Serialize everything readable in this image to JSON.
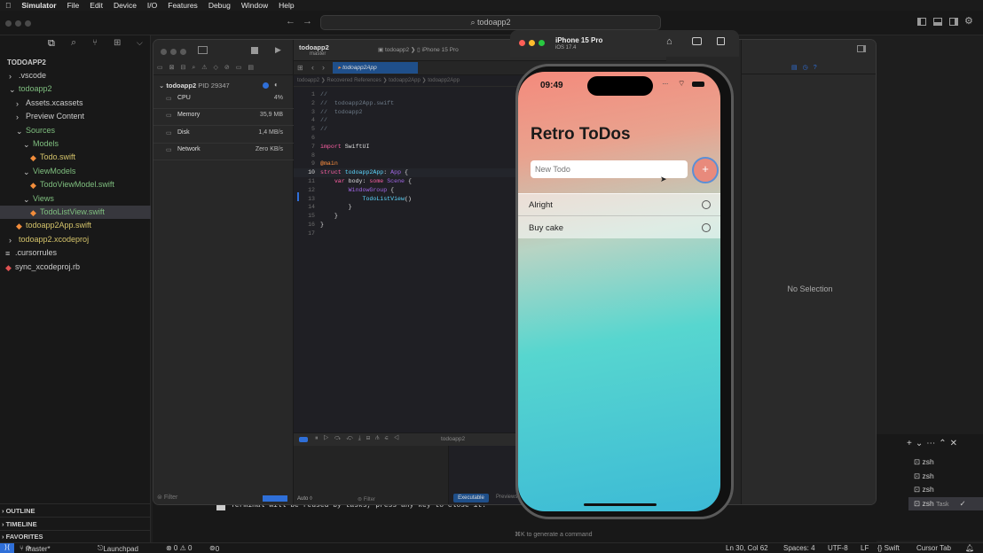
{
  "menubar": {
    "app": "Simulator",
    "items": [
      "File",
      "Edit",
      "Device",
      "I/O",
      "Features",
      "Debug",
      "Window",
      "Help"
    ]
  },
  "vscode": {
    "search": "todoapp2",
    "explorer_root": "TODOAPP2",
    "tree": [
      {
        "label": ".vscode",
        "indent": 10,
        "type": "folder-closed",
        "color": "wht"
      },
      {
        "label": "todoapp2",
        "indent": 10,
        "type": "folder-open",
        "color": "green"
      },
      {
        "label": "Assets.xcassets",
        "indent": 18,
        "type": "folder-closed",
        "color": "wht"
      },
      {
        "label": "Preview Content",
        "indent": 18,
        "type": "folder-closed",
        "color": "wht"
      },
      {
        "label": "Sources",
        "indent": 18,
        "type": "folder-open",
        "color": "green"
      },
      {
        "label": "Models",
        "indent": 26,
        "type": "folder-open",
        "color": "green"
      },
      {
        "label": "Todo.swift",
        "indent": 34,
        "type": "swift",
        "color": "yellow"
      },
      {
        "label": "ViewModels",
        "indent": 26,
        "type": "folder-open",
        "color": "green"
      },
      {
        "label": "TodoViewModel.swift",
        "indent": 34,
        "type": "swift",
        "color": "green"
      },
      {
        "label": "Views",
        "indent": 26,
        "type": "folder-open",
        "color": "green"
      },
      {
        "label": "TodoListView.swift",
        "indent": 34,
        "type": "swift",
        "color": "green",
        "selected": true
      },
      {
        "label": "todoapp2App.swift",
        "indent": 18,
        "type": "swift",
        "color": "yellow"
      },
      {
        "label": "todoapp2.xcodeproj",
        "indent": 10,
        "type": "folder-closed",
        "color": "yellow"
      },
      {
        "label": ".cursorrules",
        "indent": 6,
        "type": "file",
        "color": "wht"
      },
      {
        "label": "sync_xcodeproj.rb",
        "indent": 6,
        "type": "ruby",
        "color": "wht"
      }
    ],
    "outline": "OUTLINE",
    "timeline": "TIMELINE",
    "favorites": "FAVORITES",
    "terminal_msg": "Terminal will be reused by tasks, press any key to close it.",
    "generate_hint": "⌘K to generate a command",
    "terms": [
      "zsh",
      "zsh",
      "zsh",
      "zsh"
    ],
    "task": "Task",
    "status": {
      "branch": "master*",
      "launch": "Launchpad",
      "problems": "⊗ 0 ⚠ 0",
      "ports": "0",
      "pos": "Ln 30, Col 62",
      "spaces": "Spaces: 4",
      "enc": "UTF-8",
      "eol": "LF",
      "lang": "{} Swift",
      "tab": "Cursor Tab"
    }
  },
  "xcode": {
    "project": "todoapp2",
    "branch": "master",
    "scheme": "todoapp2",
    "device": "iPhone 15 Pro",
    "tab": "todoapp2App",
    "crumbs": [
      "todoapp2",
      "Recovered References",
      "todoapp2App",
      "todoapp2App"
    ],
    "process": "todoapp2",
    "pid": "PID 29347",
    "gauges": [
      {
        "name": "CPU",
        "value": "4%"
      },
      {
        "name": "Memory",
        "value": "35,9 MB"
      },
      {
        "name": "Disk",
        "value": "1,4 MB/s"
      },
      {
        "name": "Network",
        "value": "Zero KB/s"
      }
    ],
    "code": [
      [
        [
          "cm",
          "//"
        ]
      ],
      [
        [
          "cm",
          "//  todoapp2App.swift"
        ]
      ],
      [
        [
          "cm",
          "//  todoapp2"
        ]
      ],
      [
        [
          "cm",
          "//"
        ]
      ],
      [
        [
          "cm",
          "//"
        ]
      ],
      [],
      [
        [
          "kw",
          "import "
        ],
        [
          "tx",
          "SwiftUI"
        ]
      ],
      [],
      [
        [
          "at",
          "@main"
        ]
      ],
      [
        [
          "kw",
          "struct "
        ],
        [
          "ty",
          "todoapp2App"
        ],
        [
          "tx",
          ": "
        ],
        [
          "nm",
          "App"
        ],
        [
          "tx",
          " {"
        ]
      ],
      [
        [
          "tx",
          "    "
        ],
        [
          "kw",
          "var "
        ],
        [
          "tx",
          "body: "
        ],
        [
          "kw",
          "some "
        ],
        [
          "nm",
          "Scene"
        ],
        [
          "tx",
          " {"
        ]
      ],
      [
        [
          "tx",
          "        "
        ],
        [
          "nm",
          "WindowGroup"
        ],
        [
          "tx",
          " {"
        ]
      ],
      [
        [
          "tx",
          "            "
        ],
        [
          "ty",
          "TodoListView"
        ],
        [
          "tx",
          "()"
        ]
      ],
      [
        [
          "tx",
          "        }"
        ]
      ],
      [
        [
          "tx",
          "    }"
        ]
      ],
      [
        [
          "tx",
          "}"
        ]
      ],
      []
    ],
    "debug_label": "todoapp2",
    "filter": "Filter",
    "auto": "Auto ◊",
    "filter2": "Filter",
    "executable": "Executable",
    "previews": "Previews",
    "no_selection": "No Selection"
  },
  "simulator": {
    "device": "iPhone 15 Pro",
    "os": "iOS 17.4",
    "time": "09:49",
    "title": "Retro ToDos",
    "placeholder": "New Todo",
    "add": "+",
    "todos": [
      "Alright",
      "Buy cake"
    ]
  }
}
